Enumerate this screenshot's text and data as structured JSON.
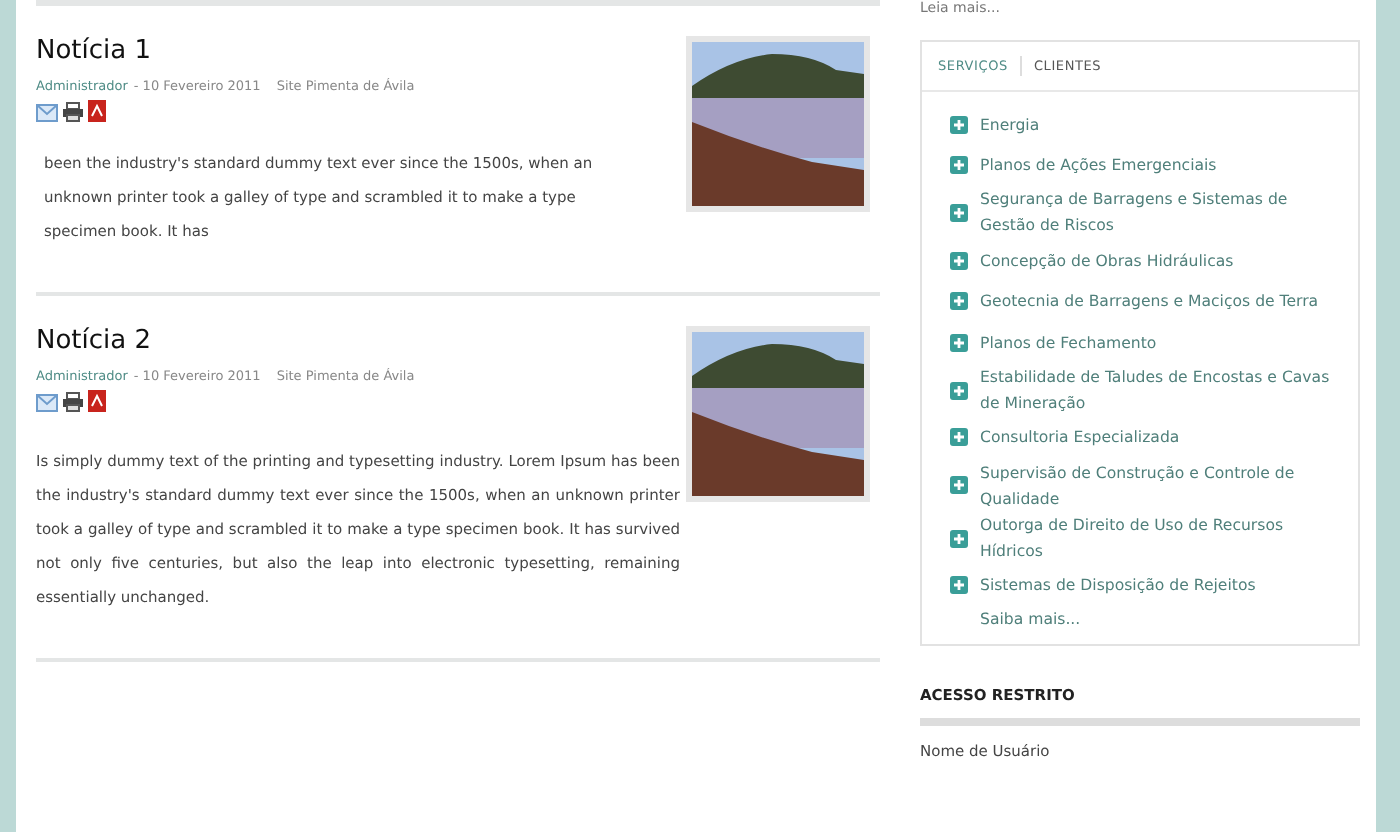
{
  "articles": [
    {
      "title": "Notícia 1",
      "author": "Administrador",
      "date": "- 10 Fevereiro 2011",
      "site": "Site Pimenta de Ávila",
      "body": "been the industry's standard dummy text ever since the 1500s, when an unknown printer took a galley of type and scrambled it to make a type specimen book. It has",
      "justify": false
    },
    {
      "title": "Notícia 2",
      "author": "Administrador",
      "date": "- 10 Fevereiro 2011",
      "site": "Site Pimenta de Ávila",
      "body": "Is simply dummy text of the printing and typesetting industry. Lorem Ipsum has been the industry's standard dummy text ever since the 1500s, when an unknown printer took a galley of type and scrambled it to make a type specimen book. It has survived not only five centuries, but also the leap into electronic typesetting, remaining essentially unchanged.",
      "justify": true
    }
  ],
  "sidebar": {
    "read_more": "Leia mais...",
    "tabs": [
      {
        "label": "SERVIÇOS",
        "selected": true
      },
      {
        "label": "CLIENTES",
        "selected": false
      }
    ],
    "services": [
      "Energia",
      "Planos de Ações Emergenciais",
      "Segurança de Barragens e Sistemas de Gestão de Riscos",
      "Concepção de Obras Hidráulicas",
      "Geotecnia de Barragens e Maciços de Terra",
      "Planos de Fechamento",
      "Estabilidade de Taludes de Encostas e Cavas de Mineração",
      "Consultoria Especializada",
      "Supervisão de Construção e Controle de Qualidade",
      "Outorga de Direito de Uso de Recursos Hídricos",
      "Sistemas de Disposição de Rejeitos"
    ],
    "more": "Saiba mais...",
    "login_title": "ACESSO RESTRITO",
    "username_label": "Nome de Usuário"
  }
}
